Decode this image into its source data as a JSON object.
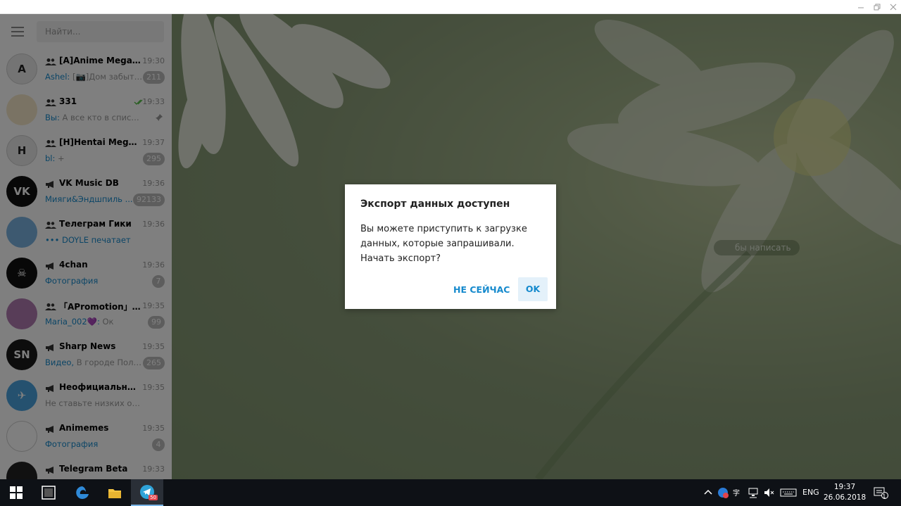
{
  "window": {
    "minimize": "minimize",
    "maximize": "restore",
    "close": "close"
  },
  "sidebar": {
    "search_placeholder": "Найти...",
    "chats": [
      {
        "name": "[A]Anime Mega[0+]",
        "time": "19:30",
        "sender": "Ashel: ",
        "message": "[📷]Дом забытых...",
        "badge": "211",
        "type": "group",
        "avatar_color": "#e8e8e8",
        "avatar_letter": "A"
      },
      {
        "name": "331",
        "time": "19:33",
        "sender": "Вы: ",
        "message": "А все кто в списке я ...",
        "badge": "",
        "type": "group",
        "pinned": true,
        "read": true,
        "avatar_color": "#f4e6c8",
        "avatar_letter": ""
      },
      {
        "name": "[H]Hentai Mega[0+]",
        "time": "19:37",
        "sender": "bl: ",
        "message": "+",
        "badge": "295",
        "type": "group",
        "avatar_color": "#e8e8e8",
        "avatar_letter": "H"
      },
      {
        "name": "VK Music DB",
        "time": "19:36",
        "sender": "",
        "message": "Мияги&Эндшпиль ...",
        "message_colored": true,
        "badge": "92133",
        "type": "channel",
        "avatar_color": "#111111",
        "avatar_letter": "VK"
      },
      {
        "name": "Телеграм Гики",
        "time": "19:36",
        "sender": "",
        "message": "••• DOYLE печатает",
        "message_colored": true,
        "badge": "",
        "type": "group",
        "avatar_color": "#7ab3e0",
        "avatar_letter": ""
      },
      {
        "name": "4chan",
        "time": "19:36",
        "sender": "",
        "message": "Фотография",
        "message_colored": true,
        "badge": "7",
        "type": "channel",
        "avatar_color": "#111111",
        "avatar_letter": "☠"
      },
      {
        "name": "「APromotion」| 0-...",
        "time": "19:35",
        "sender": "Maria_002💜: ",
        "message": "Ок",
        "badge": "99",
        "type": "group",
        "avatar_color": "#b07ab0",
        "avatar_letter": ""
      },
      {
        "name": "Sharp News",
        "time": "19:35",
        "sender": "Видео, ",
        "message": "В городе Поле...",
        "badge": "265",
        "type": "channel",
        "avatar_color": "#1a1a1a",
        "avatar_letter": "SN"
      },
      {
        "name": "Неофициальные...",
        "time": "19:35",
        "sender": "",
        "message": "Не ставьте низких оценок...",
        "badge": "",
        "type": "channel",
        "avatar_color": "#4aa3df",
        "avatar_letter": "✈"
      },
      {
        "name": "Animemes",
        "time": "19:35",
        "sender": "",
        "message": "Фотография",
        "message_colored": true,
        "badge": "4",
        "type": "channel",
        "avatar_color": "#ffffff",
        "avatar_letter": ""
      },
      {
        "name": "Telegram Beta",
        "time": "19:33",
        "sender": "",
        "message": "",
        "badge": "",
        "type": "channel",
        "avatar_color": "#222222",
        "avatar_letter": ""
      }
    ]
  },
  "main": {
    "hint": "бы написать"
  },
  "dialog": {
    "title": "Экспорт данных доступен",
    "text": "Вы можете приступить к загрузке данных, которые запрашивали. Начать экспорт?",
    "cancel_label": "НЕ СЕЙЧАС",
    "ok_label": "OK"
  },
  "taskbar": {
    "telegram_badge": "50",
    "lang": "ENG",
    "time": "19:37",
    "date": "26.06.2018",
    "notification_count": "1"
  },
  "colors": {
    "accent": "#168acd",
    "badge": "#bbbbbb",
    "taskbar": "#0e1116"
  }
}
